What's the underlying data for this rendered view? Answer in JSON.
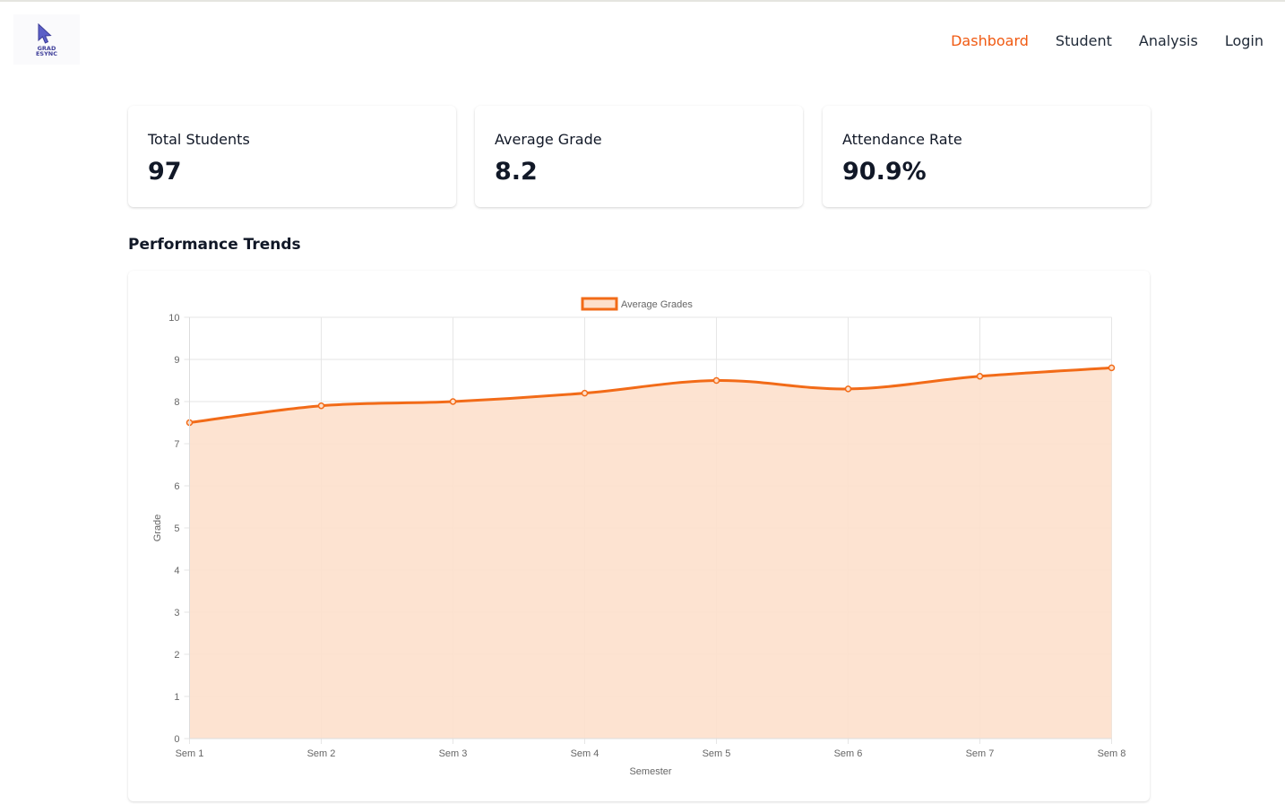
{
  "header": {
    "logo_text_line1": "GRAD",
    "logo_text_line2": "ESYNC",
    "nav": [
      {
        "label": "Dashboard",
        "active": true
      },
      {
        "label": "Student",
        "active": false
      },
      {
        "label": "Analysis",
        "active": false
      },
      {
        "label": "Login",
        "active": false
      }
    ]
  },
  "stats": [
    {
      "label": "Total Students",
      "value": "97"
    },
    {
      "label": "Average Grade",
      "value": "8.2"
    },
    {
      "label": "Attendance Rate",
      "value": "90.9%"
    }
  ],
  "section_title": "Performance Trends",
  "colors": {
    "accent": "#f05a12",
    "line": "#f26b18",
    "fill": "#fde0cc",
    "grid": "#e6e6e6"
  },
  "chart_data": {
    "type": "area",
    "categories": [
      "Sem 1",
      "Sem 2",
      "Sem 3",
      "Sem 4",
      "Sem 5",
      "Sem 6",
      "Sem 7",
      "Sem 8"
    ],
    "series": [
      {
        "name": "Average Grades",
        "values": [
          7.5,
          7.9,
          8.0,
          8.2,
          8.5,
          8.3,
          8.6,
          8.8
        ]
      }
    ],
    "xlabel": "Semester",
    "ylabel": "Grade",
    "ylim": [
      0,
      10
    ],
    "yticks": [
      0,
      1,
      2,
      3,
      4,
      5,
      6,
      7,
      8,
      9,
      10
    ],
    "grid": true,
    "legend": "top-center"
  }
}
